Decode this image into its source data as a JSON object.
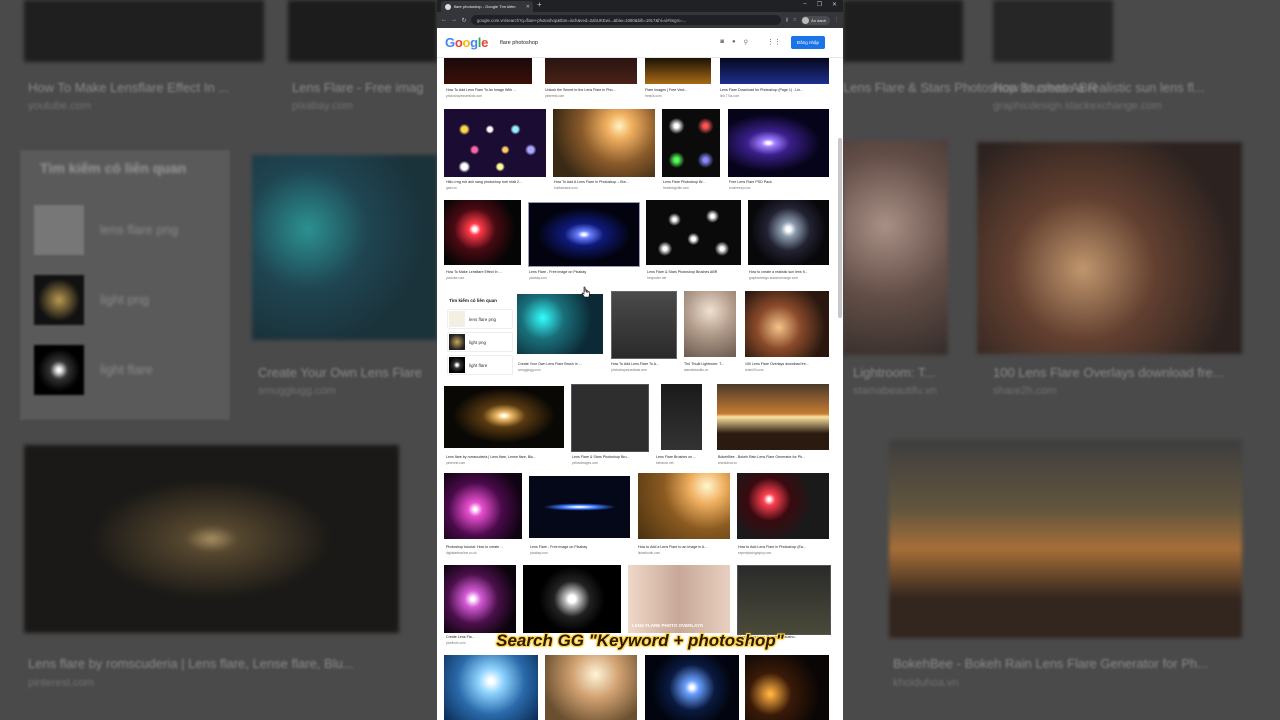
{
  "tab": {
    "title": "flare photoshop - Google Tìm kiếm",
    "new_tab": "+"
  },
  "window_controls": [
    "–",
    "❐",
    "✕"
  ],
  "address": {
    "url": "google.com.vn/search?q=flare+photoshop&tbm=isch&ved=2ahUKEwi...&biw=1080&bih=1917&hl=vi#imgrc=...",
    "profile": "Ẩn danh"
  },
  "header": {
    "logo": [
      "G",
      "o",
      "o",
      "g",
      "l",
      "e"
    ],
    "query": "flare photoshop",
    "signin": "Đăng nhập"
  },
  "related": {
    "title": "Tìm kiếm có liên quan",
    "items": [
      "lens flare png",
      "light png",
      "light flare"
    ]
  },
  "results": [
    {
      "caption": "How To Add Lens Flare To An Image With ...",
      "source": "photoshopessentials.com"
    },
    {
      "caption": "Unlock the Secret to the Lens Flare in Pho...",
      "source": "pinterest.com"
    },
    {
      "caption": "Flare Images | Free Vect...",
      "source": "freepik.com"
    },
    {
      "caption": "Lens Flare Download for Photoshop (Page 1) - Lin...",
      "source": "link.77ss.com"
    },
    {
      "caption": "Hiệu ứng mờ ánh sáng photoshop mới nhất 2...",
      "source": "gasir.vn"
    },
    {
      "caption": "How To Add A Lens Flare In Photoshop – Bre...",
      "source": "bodtarealce.com"
    },
    {
      "caption": "Lens Flare Photoshop Br...",
      "source": "freedesignfile.com"
    },
    {
      "caption": "Free Lens Flare PSD Pack",
      "source": "brusheezy.com"
    },
    {
      "caption": "How To Make Lensflare Effect In ...",
      "source": "youtube.com"
    },
    {
      "caption": "Lens Flare - Free image on Pixabay",
      "source": "pixabay.com"
    },
    {
      "caption": "Lens Flare & Stars Photoshop Brushes ABR",
      "source": "freepsdvn.net"
    },
    {
      "caption": "How to create a realistic sun lens fl...",
      "source": "graphicdesign.stackexchange.com"
    },
    {
      "caption": "Create Your Own Lens Flare Brush In ...",
      "source": "smugglugg.com"
    },
    {
      "caption": "How To Add Lens Flare To A...",
      "source": "photoshopessentials.com"
    },
    {
      "caption": "Thủ Thuật Lightroom: T...",
      "source": "stamabeautifu.vn"
    },
    {
      "caption": "100 Lens Flare Overlays download fre...",
      "source": "share2h.com"
    },
    {
      "caption": "Lens flare by romscuderia | Lens flare, Lense flare, Blu...",
      "source": "pinterest.com"
    },
    {
      "caption": "Lens Flare & Stars Photoshop Bru...",
      "source": "yellowimages.com"
    },
    {
      "caption": "Lens Flare Brushes on ...",
      "source": "behance.net"
    },
    {
      "caption": "BokehBee - Bokeh Rain Lens Flare Generator for Ph...",
      "source": "khoiduhoa.vn"
    },
    {
      "caption": "Photoshop tutorial: How to create ...",
      "source": "digitalartsonline.co.uk"
    },
    {
      "caption": "Lens Flare - Free image on Pixabay",
      "source": "pixabay.com"
    },
    {
      "caption": "How to Add a Lens Flare to an Image in A...",
      "source": "linkedoutin.com"
    },
    {
      "caption": "How to Add Lens Flare in Photoshop (Ea...",
      "source": "expertphotography.com"
    },
    {
      "caption": "Create Lens Fla...",
      "source": "pixelhole.com"
    },
    {
      "caption": "LENS FLARE PHOTO OVERLAYS",
      "source": ""
    },
    {
      "caption": "How to Add Lens Flare in Photosho...",
      "source": "photoshopbuzz.com"
    }
  ],
  "overlay_text": "Search GG \"Keyword + photoshop\"",
  "bg_left": {
    "captions": [
      "How To Make Lensflare Effect In ...",
      "Lens Flare - Free imag",
      "Create Your Own Lens Flare",
      "Lens flare by romscuderia | Lens flare, Lense flare, Blu..."
    ],
    "sources": [
      "youtube.com",
      "pixabay.com",
      "smugglugg.com",
      "pinterest.com"
    ],
    "related_title": "Tìm kiếm có liên quan",
    "related_items": [
      "lens flare png",
      "light png",
      "light flare"
    ]
  },
  "bg_right": {
    "captions": [
      "Lens Flare & Stars Photoshop Brushes ABR",
      "How to create a realistic sun lens fl...",
      "Lightroom: T...",
      "100 Lens Flare Overlays download fre...",
      "BokehBee - Bokeh Rain Lens Flare Generator for Ph..."
    ],
    "sources": [
      "freepsdvn.net",
      "graphicdesign.stackexchange.com",
      "stamabeautifu.vn",
      "share2h.com",
      "khoiduhoa.vn"
    ]
  }
}
